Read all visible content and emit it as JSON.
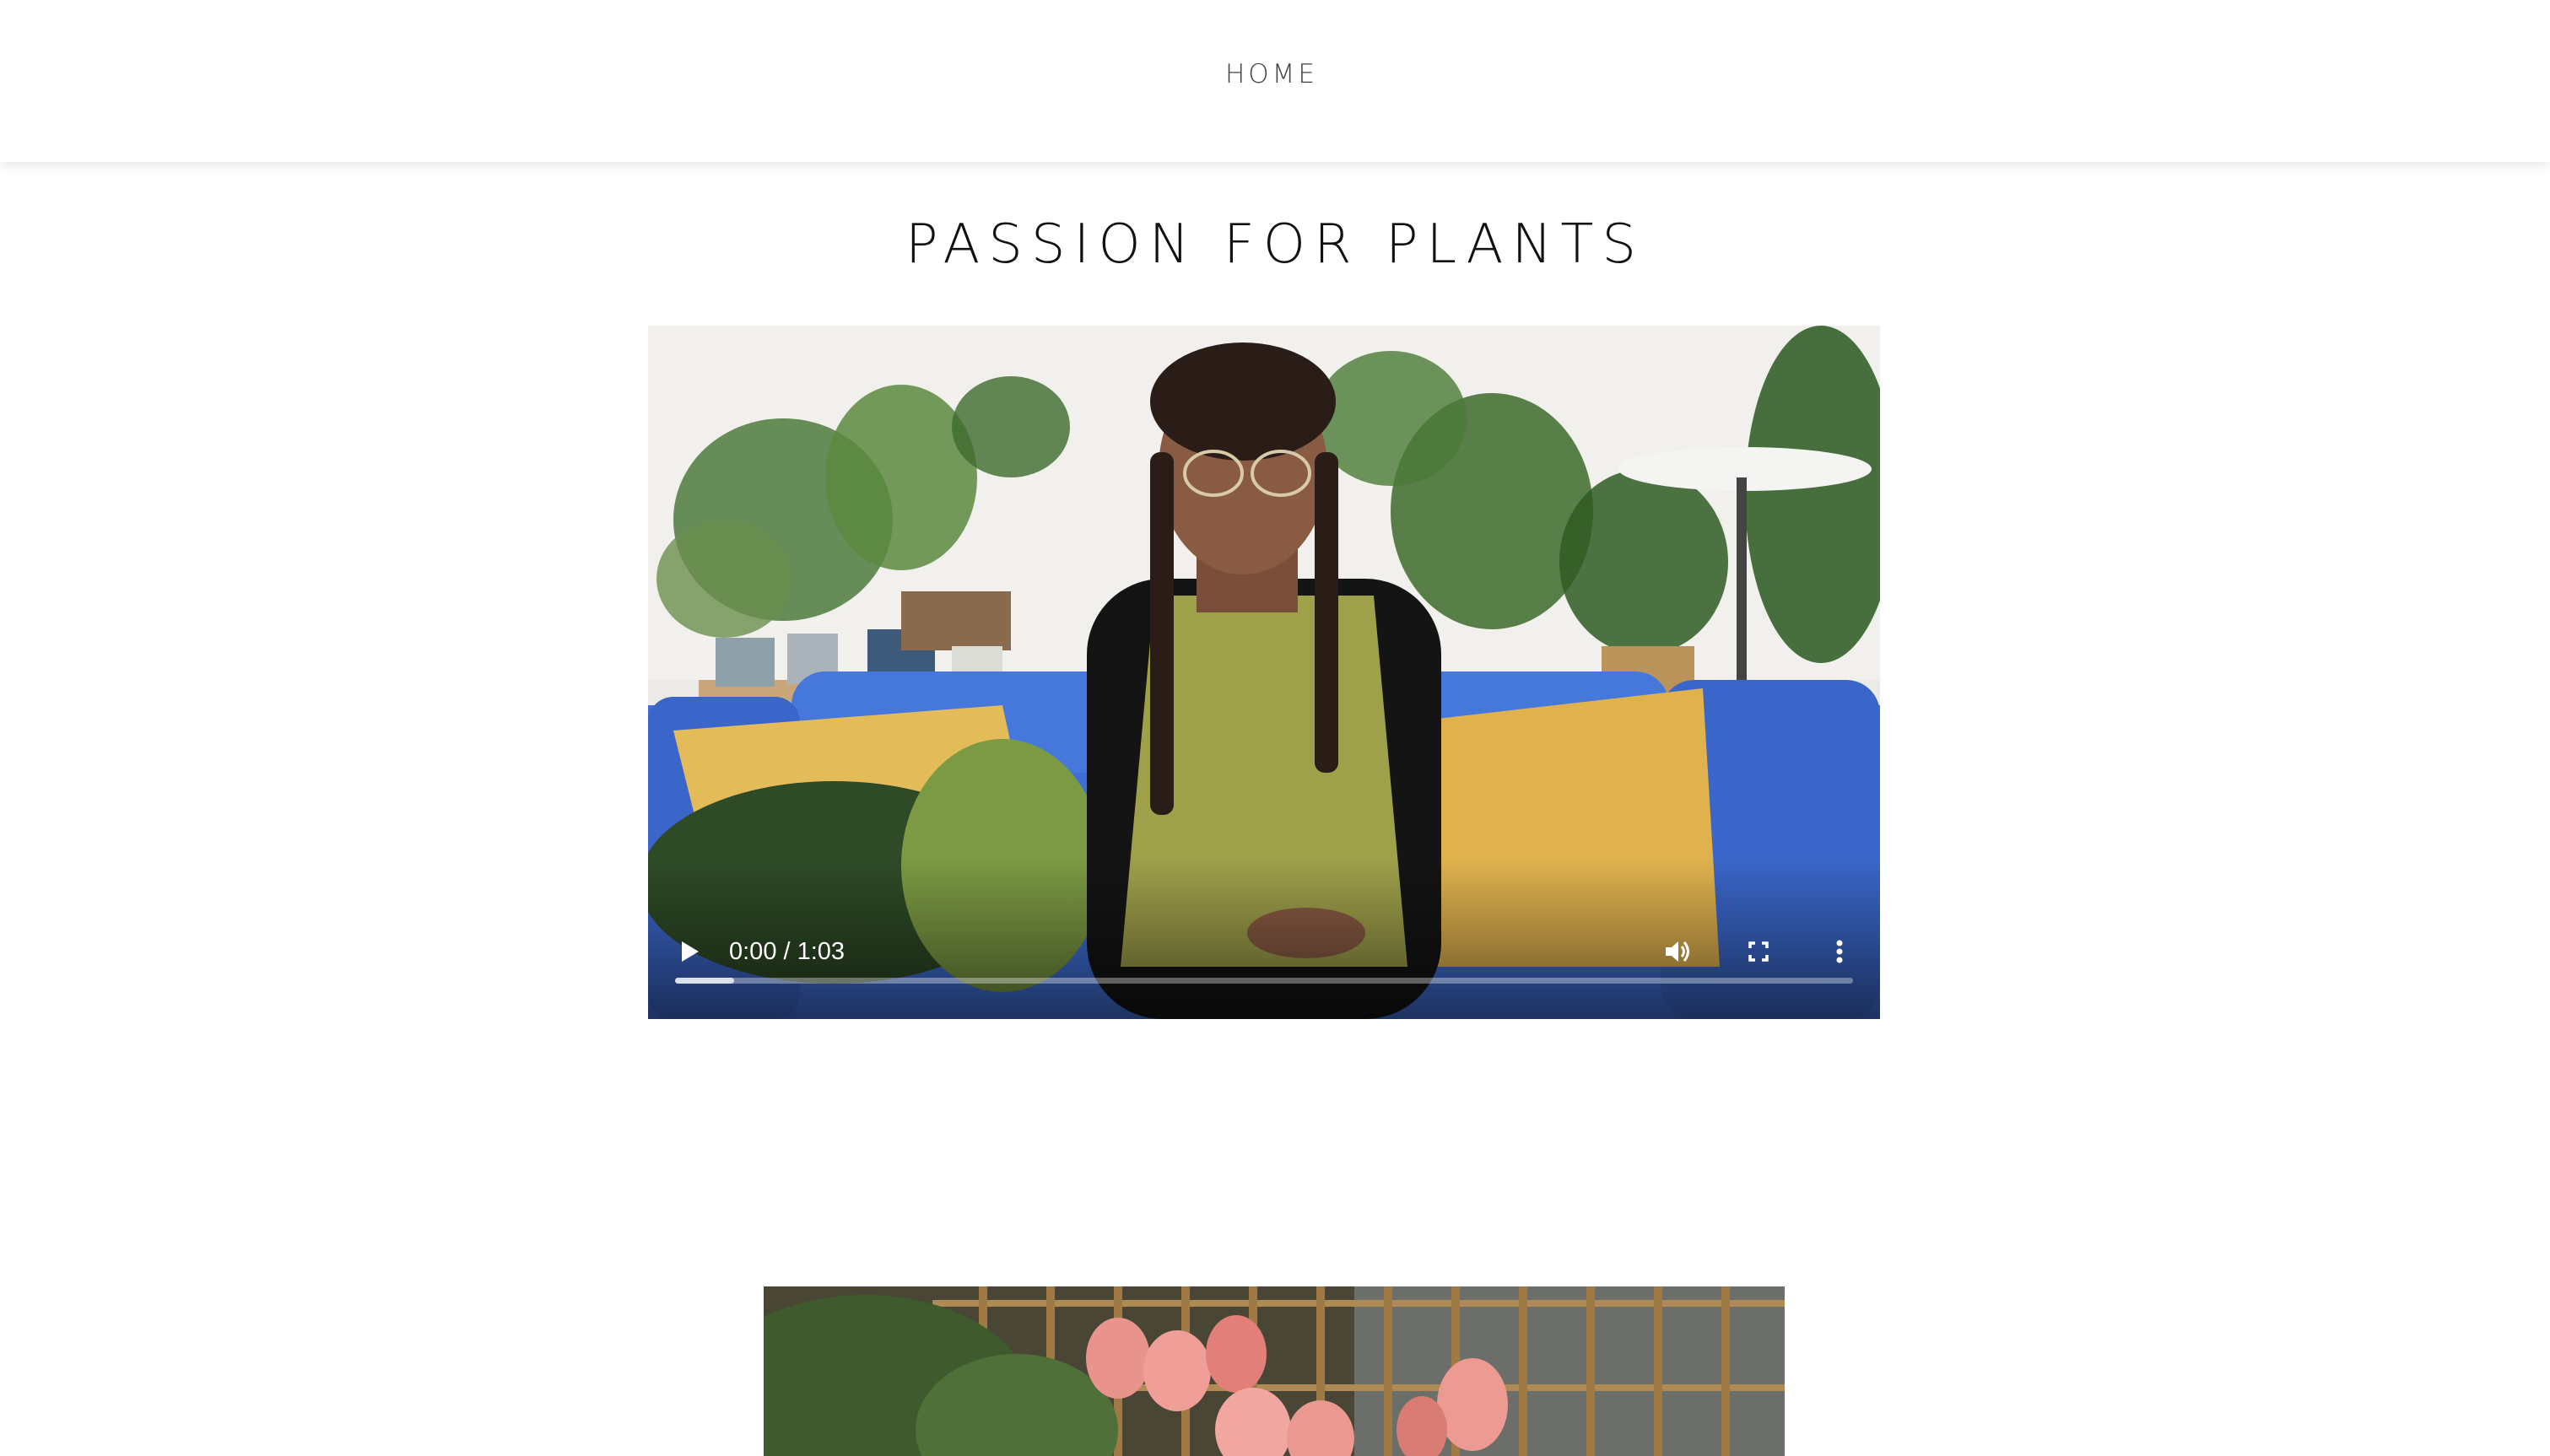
{
  "nav": {
    "home_label": "HOME"
  },
  "page": {
    "title": "PASSION FOR PLANTS"
  },
  "video": {
    "time_display": "0:00 / 1:03",
    "buffered": 0.05,
    "icons": {
      "play": "play-icon",
      "volume": "volume-icon",
      "fullscreen": "fullscreen-icon",
      "more": "more-vert-icon"
    }
  },
  "colors": {
    "nav_text": "#444444",
    "title_text": "#111111",
    "sofa_blue": "#3f6fd6",
    "cushion_yellow": "#e0b24e"
  }
}
